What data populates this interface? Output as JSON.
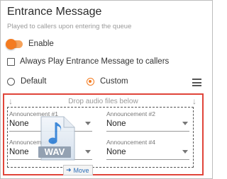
{
  "header": {
    "title": "Entrance Message",
    "subtitle": "Played to callers upon entering the queue"
  },
  "enable": {
    "label": "Enable",
    "on": true,
    "accent_color": "#f47b20"
  },
  "always_play": {
    "label": "Always Play Entrance Message to callers",
    "checked": false
  },
  "message_type": {
    "options": [
      {
        "label": "Default",
        "selected": false
      },
      {
        "label": "Custom",
        "selected": true
      }
    ],
    "menu_icon": "hamburger-menu-icon"
  },
  "drop_zone": {
    "text": "Drop audio files below",
    "arrow_icon": "arrow-down-icon",
    "border_color": "#e0453a"
  },
  "announcements": [
    {
      "label": "Announcement #1",
      "value": "None"
    },
    {
      "label": "Announcement #2",
      "value": "None"
    },
    {
      "label": "Announcement #3",
      "value": "None"
    },
    {
      "label": "Announcement #4",
      "value": "None"
    }
  ],
  "drag": {
    "file_badge": "WAV",
    "file_icon": "wav-file-icon",
    "action_label": "Move",
    "action_icon": "move-arrow-icon"
  }
}
